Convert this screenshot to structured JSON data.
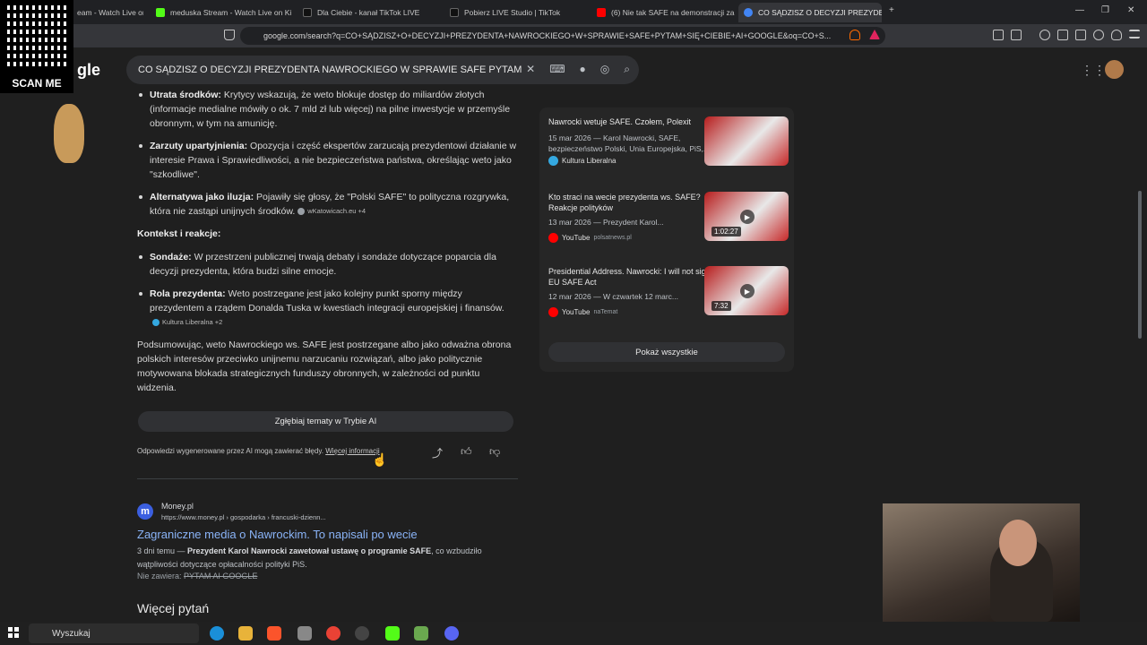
{
  "tabs": [
    {
      "label": "eam - Watch Live on",
      "color": "#53fc18"
    },
    {
      "label": "meduska Stream - Watch Live on Ki",
      "color": "#53fc18"
    },
    {
      "label": "Dla Ciebie - kanał TikTok LIVE",
      "color": "#000000"
    },
    {
      "label": "Pobierz LIVE Studio | TikTok",
      "color": "#000000"
    },
    {
      "label": "(6) Nie tak SAFE na demonstracji za",
      "color": "#ff0000"
    },
    {
      "label": "CO SĄDZISZ O DECYZJI PREZYDE",
      "color": "#4285f4"
    }
  ],
  "url": "google.com/search?q=CO+SĄDZISZ+O+DECYZJI+PREZYDENTA+NAWROCKIEGO+W+SPRAWIE+SAFE+PYTAM+SIĘ+CIEBIE+AI+GOOGLE&oq=CO+S...",
  "overlay": {
    "qr_label": "SCAN ME",
    "logo_partial": "gle"
  },
  "search_query": "CO SĄDZISZ O DECYZJI PREZYDENTA NAWROCKIEGO W SPRAWIE SAFE PYTAM",
  "ai": {
    "bullets1": [
      {
        "bold": "Utrata środków:",
        "text": " Krytycy wskazują, że weto blokuje dostęp do miliardów złotych (informacje medialne mówiły o ok. 7 mld zł lub więcej) na pilne inwestycje w przemyśle obronnym, w tym na amunicję."
      },
      {
        "bold": "Zarzuty upartyjnienia:",
        "text": " Opozycja i część ekspertów zarzucają prezydentowi działanie w interesie Prawa i Sprawiedliwości, a nie bezpieczeństwa państwa, określając weto jako \"szkodliwe\"."
      },
      {
        "bold": "Alternatywa jako iluzja:",
        "text": " Pojawiły się głosy, że \"Polski SAFE\" to polityczna rozgrywka, która nie zastąpi unijnych środków.",
        "source": "wKatowicach.eu +4"
      }
    ],
    "section": "Kontekst i reakcje:",
    "bullets2": [
      {
        "bold": "Sondaże:",
        "text": " W przestrzeni publicznej trwają debaty i sondaże dotyczące poparcia dla decyzji prezydenta, która budzi silne emocje."
      },
      {
        "bold": "Rola prezydenta:",
        "text": " Weto postrzegane jest jako kolejny punkt sporny między prezydentem a rządem Donalda Tuska w kwestiach integracji europejskiej i finansów.",
        "source": "Kultura Liberalna +2"
      }
    ],
    "summary": "Podsumowując, weto Nawrockiego ws. SAFE jest postrzegane albo jako odważna obrona polskich interesów przeciwko unijnemu narzucaniu rozwiązań, albo jako politycznie motywowana blokada strategicznych funduszy obronnych, w zależności od punktu widzenia.",
    "deep_button": "Zgłębiaj tematy w Trybie AI",
    "disclaimer": "Odpowiedzi wygenerowane przez AI mogą zawierać błędy.",
    "more_info": "Więcej informacji"
  },
  "result": {
    "site": "Money.pl",
    "url": "https://www.money.pl › gospodarka › francuski-dzienn...",
    "title": "Zagraniczne media o Nawrockim. To napisali po wecie",
    "snippet_pre": "3 dni temu — ",
    "snippet_bold": "Prezydent Karol Nawrocki zawetował ustawę o programie SAFE",
    "snippet_post": ", co wzbudziło wątpliwości dotyczące opłacalności polityki PiS.",
    "missing_label": "Nie zawiera: ",
    "missing_terms": "PYTAM AI GOOGLE"
  },
  "more_questions": "Więcej pytań",
  "videos": [
    {
      "title": "Nawrocki wetuje SAFE. Czołem, Polexit",
      "desc": "15 mar 2026 — Karol Nawrocki, SAFE, bezpieczeństwo Polski, Unia Europejska, PiS,...",
      "source": "Kultura Liberalna",
      "source_sub": "",
      "duration": ""
    },
    {
      "title": "Kto straci na wecie prezydenta ws. SAFE? Reakcje polityków",
      "desc": "13 mar 2026 — Prezydent Karol...",
      "source": "YouTube",
      "source_sub": "polsatnews.pl",
      "duration": "1:02:27"
    },
    {
      "title": "Presidential Address. Nawrocki: I will not sign the EU SAFE Act",
      "desc": "12 mar 2026 — W czwartek 12 marc...",
      "source": "YouTube",
      "source_sub": "naTemat",
      "duration": "7:32"
    }
  ],
  "show_all": "Pokaż wszystkie",
  "taskbar": {
    "search": "Wyszukaj"
  }
}
